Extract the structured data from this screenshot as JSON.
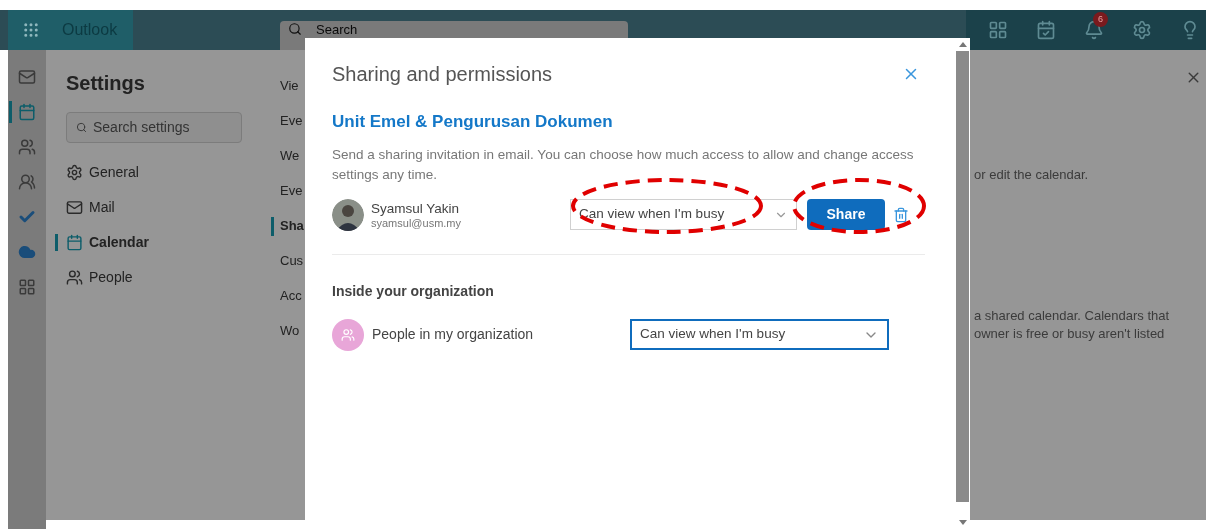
{
  "app_bar": {
    "app_name": "Outlook",
    "search": {
      "placeholder": "Search"
    },
    "notifications_badge": "6"
  },
  "left_rail": [
    {
      "kind": "mail",
      "selected": false
    },
    {
      "kind": "calendar",
      "selected": true
    },
    {
      "kind": "people",
      "selected": false
    },
    {
      "kind": "groups",
      "selected": false
    },
    {
      "kind": "todo",
      "selected": false
    },
    {
      "kind": "cloud",
      "selected": false
    },
    {
      "kind": "apps",
      "selected": false
    }
  ],
  "settings": {
    "title": "Settings",
    "search": {
      "placeholder": "Search settings"
    },
    "nav": [
      {
        "kind": "gear",
        "label": "General",
        "selected": false
      },
      {
        "kind": "mail",
        "label": "Mail",
        "selected": false
      },
      {
        "kind": "calendar",
        "label": "Calendar",
        "selected": true
      },
      {
        "kind": "people",
        "label": "People",
        "selected": false
      }
    ],
    "subnav": [
      {
        "label": "Vie",
        "selected": false
      },
      {
        "label": "Eve",
        "selected": false
      },
      {
        "label": "We",
        "selected": false
      },
      {
        "label": "Eve",
        "selected": false
      },
      {
        "label": "Sha",
        "selected": true
      },
      {
        "label": "Cus",
        "selected": false
      },
      {
        "label": "Acc",
        "selected": false
      },
      {
        "label": "Wo",
        "selected": false
      }
    ],
    "content_fragments": [
      "or edit the calendar.",
      "a shared calendar. Calendars that",
      "owner is free or busy aren't listed"
    ]
  },
  "dialog": {
    "title": "Sharing and permissions",
    "calendar_name": "Unit Emel & Pengurusan Dokumen",
    "description": "Send a sharing invitation in email. You can choose how much access to allow and change access settings any time.",
    "shared_with": [
      {
        "name": "Syamsul Yakin",
        "email": "syamsul@usm.my",
        "permission": "Can view when I'm busy"
      }
    ],
    "share_button": "Share",
    "organization": {
      "heading": "Inside your organization",
      "entries": [
        {
          "name": "People in my organization",
          "permission": "Can view when I'm busy",
          "focused": true
        }
      ]
    }
  }
}
